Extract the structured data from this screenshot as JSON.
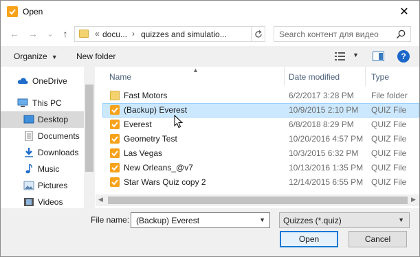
{
  "window": {
    "title": "Open",
    "close_glyph": "✕"
  },
  "nav": {
    "back_glyph": "←",
    "forward_glyph": "→",
    "recent_glyph": "⌄",
    "up_glyph": "↑",
    "breadcrumb": {
      "overflow": "«",
      "items": [
        "docu...",
        "quizzes and simulatio..."
      ],
      "separator": "›"
    },
    "search_placeholder": "Search контент для видео"
  },
  "toolbar": {
    "organize_label": "Organize",
    "new_folder_label": "New folder",
    "help_label": "?"
  },
  "sidebar": {
    "items": [
      {
        "label": "OneDrive",
        "icon": "cloud-icon"
      },
      {
        "label": "This PC",
        "icon": "computer-icon"
      },
      {
        "label": "Desktop",
        "icon": "desktop-icon",
        "selected": true
      },
      {
        "label": "Documents",
        "icon": "documents-icon"
      },
      {
        "label": "Downloads",
        "icon": "download-icon"
      },
      {
        "label": "Music",
        "icon": "music-icon"
      },
      {
        "label": "Pictures",
        "icon": "pictures-icon"
      },
      {
        "label": "Videos",
        "icon": "videos-icon"
      }
    ]
  },
  "file_list": {
    "columns": {
      "name": "Name",
      "date": "Date modified",
      "type": "Type"
    },
    "rows": [
      {
        "name": "Fast Motors",
        "date": "6/2/2017 3:28 PM",
        "type": "File folder",
        "icon": "folder-icon"
      },
      {
        "name": "(Backup) Everest",
        "date": "10/9/2015 2:10 PM",
        "type": "QUIZ File",
        "icon": "quiz-file-icon",
        "selected": true
      },
      {
        "name": "Everest",
        "date": "6/8/2018 8:29 PM",
        "type": "QUIZ File",
        "icon": "quiz-file-icon"
      },
      {
        "name": "Geometry Test",
        "date": "10/20/2016 4:57 PM",
        "type": "QUIZ File",
        "icon": "quiz-file-icon"
      },
      {
        "name": "Las Vegas",
        "date": "10/3/2015 6:32 PM",
        "type": "QUIZ File",
        "icon": "quiz-file-icon"
      },
      {
        "name": "New Orleans_@v7",
        "date": "10/13/2016 1:35 PM",
        "type": "QUIZ File",
        "icon": "quiz-file-icon"
      },
      {
        "name": "Star Wars Quiz copy 2",
        "date": "12/14/2015 6:55 PM",
        "type": "QUIZ File",
        "icon": "quiz-file-icon"
      }
    ]
  },
  "bottom": {
    "file_name_label": "File name:",
    "file_name_value": "(Backup) Everest",
    "file_type_value": "Quizzes (*.quiz)",
    "open_label": "Open",
    "cancel_label": "Cancel"
  },
  "colors": {
    "accent": "#0078d7",
    "quiz": "#f7a21b",
    "folder": "#f3d26f",
    "selection": "#cce8ff"
  }
}
